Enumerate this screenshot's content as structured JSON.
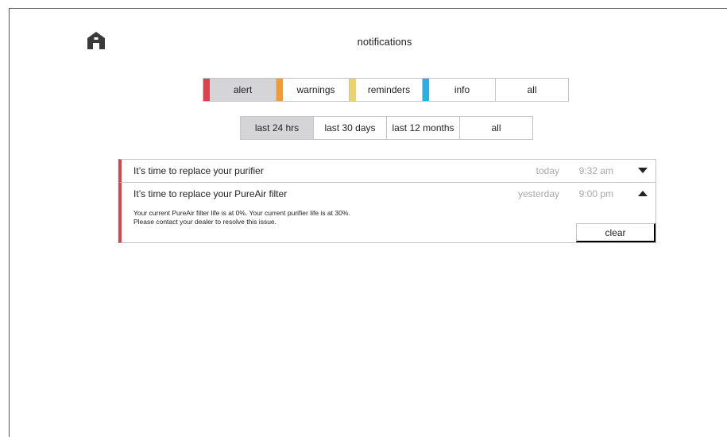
{
  "header": {
    "title": "notifications",
    "home_icon": "home-icon"
  },
  "category_tabs": [
    {
      "label": "alert",
      "color": "#d9434d",
      "active": true
    },
    {
      "label": "warnings",
      "color": "#f59a32",
      "active": false
    },
    {
      "label": "reminders",
      "color": "#ecd26a",
      "active": false
    },
    {
      "label": "info",
      "color": "#2aaee6",
      "active": false
    },
    {
      "label": "all",
      "color": "",
      "active": false
    }
  ],
  "time_tabs": [
    {
      "label": "last 24 hrs",
      "active": true
    },
    {
      "label": "last 30 days",
      "active": false
    },
    {
      "label": "last 12 months",
      "active": false
    },
    {
      "label": "all",
      "active": false
    }
  ],
  "notifications": [
    {
      "title": "It’s time to replace your purifier",
      "date": "today",
      "time": "9:32 am",
      "expanded": false,
      "chevron_icon": "chevron-down-icon"
    },
    {
      "title": "It’s time to replace your PureAir filter",
      "date": "yesterday",
      "time": "9:00 pm",
      "expanded": true,
      "chevron_icon": "chevron-up-icon",
      "body_line1": "Your current PureAir filter life is at 0%. Your current purifier life is at 30%.",
      "body_line2": "Please contact your dealer to resolve this issue.",
      "clear_label": "clear"
    }
  ],
  "colors": {
    "alert_red": "#d9434d",
    "active_tab_bg": "#d5d5d7",
    "muted_text": "#a8a8a8"
  }
}
